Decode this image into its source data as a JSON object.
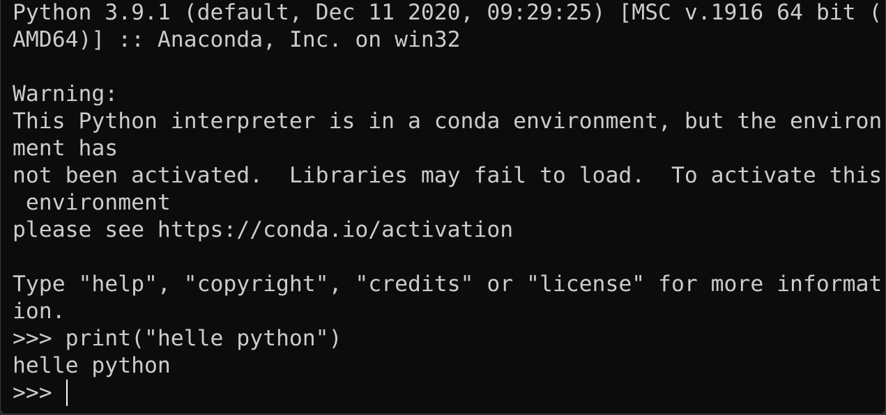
{
  "terminal": {
    "lines": [
      "Python 3.9.1 (default, Dec 11 2020, 09:29:25) [MSC v.1916 64 bit (",
      "AMD64)] :: Anaconda, Inc. on win32",
      "",
      "Warning:",
      "This Python interpreter is in a conda environment, but the environ",
      "ment has",
      "not been activated.  Libraries may fail to load.  To activate this",
      " environment",
      "please see https://conda.io/activation",
      "",
      "Type \"help\", \"copyright\", \"credits\" or \"license\" for more informat",
      "ion.",
      ">>> print(\"helle python\")",
      "helle python"
    ],
    "prompt": ">>> ",
    "colors": {
      "background": "#0c0c0c",
      "foreground": "#cccccc",
      "cursor": "#ffffff"
    }
  }
}
